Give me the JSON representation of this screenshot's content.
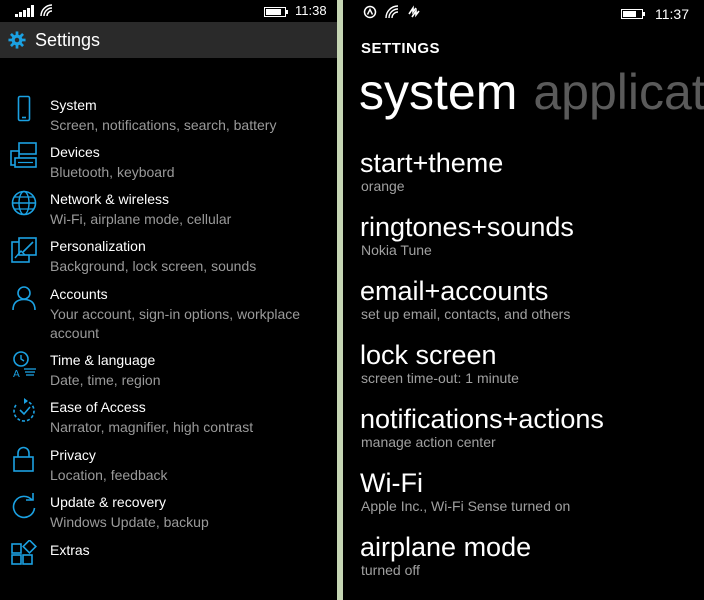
{
  "left_phone": {
    "status_bar": {
      "time": "11:38",
      "signal_icon": "signal-bars-icon",
      "wifi_icon": "wifi-icon",
      "battery_icon": "battery-icon"
    },
    "title": "Settings",
    "accent_color": "#1ba1e2",
    "items": [
      {
        "icon": "phone-icon",
        "title": "System",
        "subtitle": "Screen, notifications, search, battery"
      },
      {
        "icon": "devices-icon",
        "title": "Devices",
        "subtitle": "Bluetooth, keyboard"
      },
      {
        "icon": "globe-icon",
        "title": "Network & wireless",
        "subtitle": "Wi-Fi, airplane mode, cellular"
      },
      {
        "icon": "personalization-icon",
        "title": "Personalization",
        "subtitle": "Background, lock screen, sounds"
      },
      {
        "icon": "person-icon",
        "title": "Accounts",
        "subtitle": "Your account, sign-in options, workplace account"
      },
      {
        "icon": "time-language-icon",
        "title": "Time & language",
        "subtitle": "Date, time, region"
      },
      {
        "icon": "ease-of-access-icon",
        "title": "Ease of Access",
        "subtitle": "Narrator, magnifier, high contrast"
      },
      {
        "icon": "lock-icon",
        "title": "Privacy",
        "subtitle": "Location, feedback"
      },
      {
        "icon": "refresh-icon",
        "title": "Update & recovery",
        "subtitle": "Windows Update, backup"
      },
      {
        "icon": "extras-icon",
        "title": "Extras",
        "subtitle": ""
      }
    ]
  },
  "right_phone": {
    "status_bar": {
      "time": "11:37",
      "icons": [
        "nfc-icon",
        "wifi-icon",
        "data-sense-icon",
        "battery-icon"
      ]
    },
    "header": "SETTINGS",
    "pivot": {
      "active": "system",
      "next": "applicat"
    },
    "items": [
      {
        "title": "start+theme",
        "subtitle": "orange"
      },
      {
        "title": "ringtones+sounds",
        "subtitle": "Nokia Tune"
      },
      {
        "title": "email+accounts",
        "subtitle": "set up email, contacts, and others"
      },
      {
        "title": "lock screen",
        "subtitle": "screen time-out: 1 minute"
      },
      {
        "title": "notifications+actions",
        "subtitle": "manage action center"
      },
      {
        "title": "Wi-Fi",
        "subtitle": "Apple Inc., Wi-Fi Sense turned on"
      },
      {
        "title": "airplane mode",
        "subtitle": "turned off"
      }
    ]
  }
}
